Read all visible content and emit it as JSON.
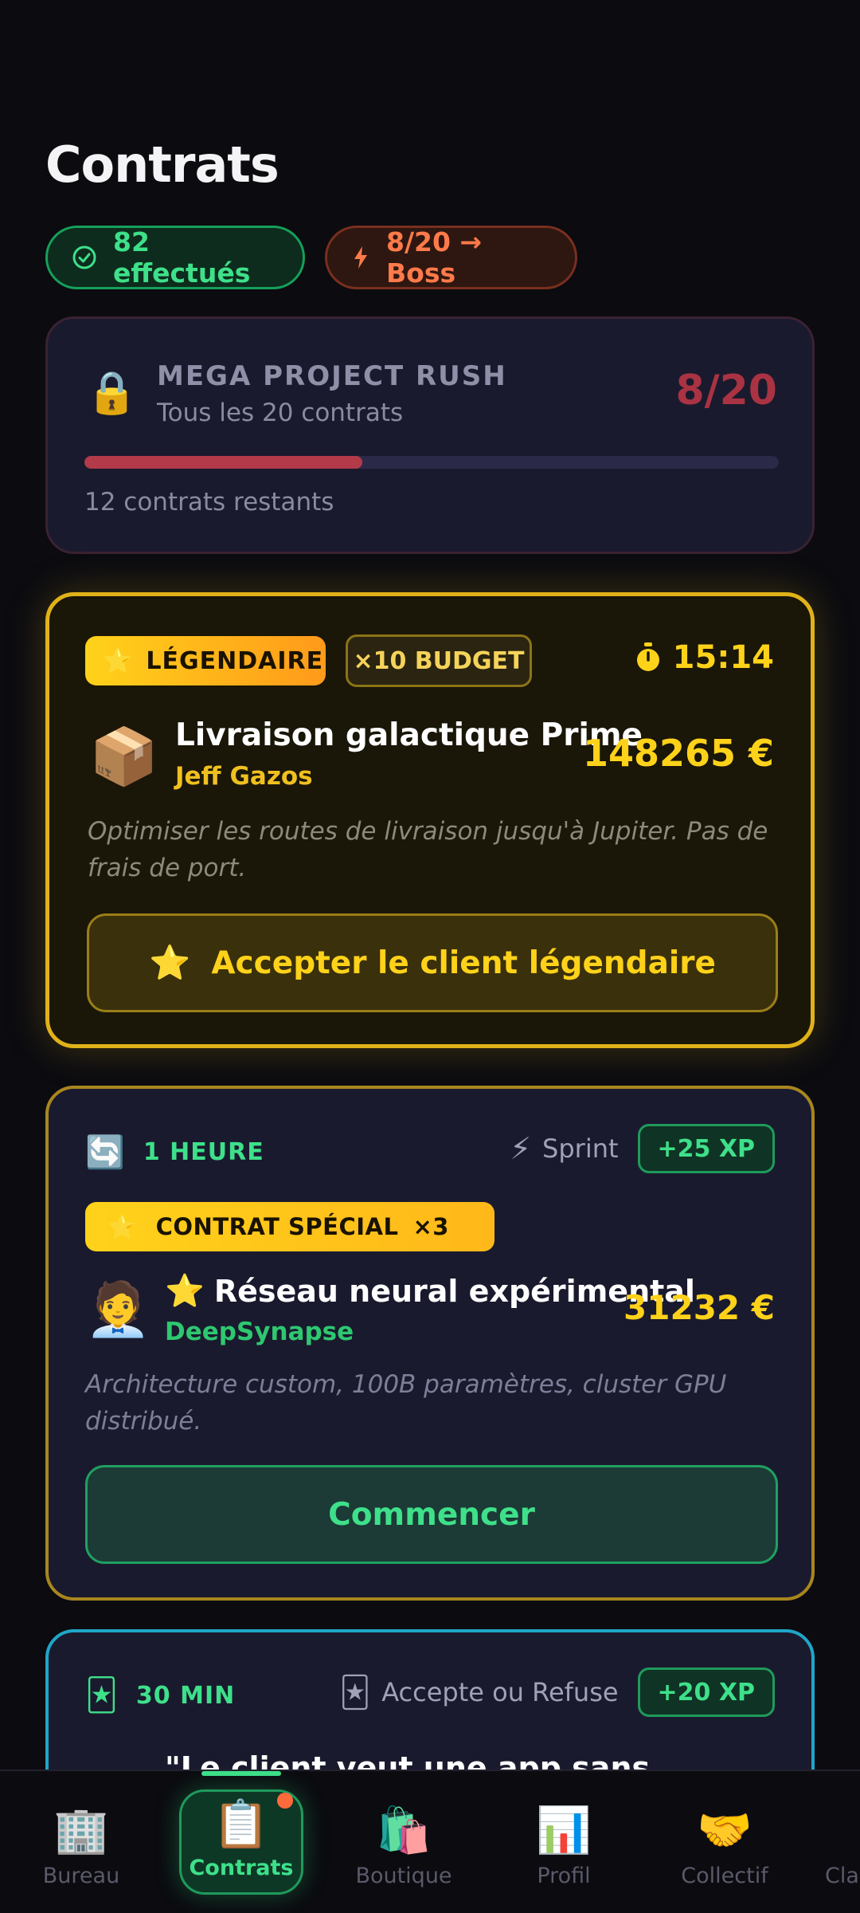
{
  "page": {
    "title": "Contrats"
  },
  "chips": {
    "done": "82 effectués",
    "boss": "8/20 → Boss"
  },
  "boss": {
    "title": "MEGA PROJECT RUSH",
    "subtitle": "Tous les 20 contrats",
    "count": "8/20",
    "progress": 0.4,
    "remaining": "12 contrats restants",
    "icon": "lock-icon"
  },
  "legendary": {
    "badge": "LÉGENDAIRE",
    "budget": "×10 BUDGET",
    "timer": "15:14",
    "name": "Livraison galactique Prime",
    "client": "Jeff Gazos",
    "price": "148265 €",
    "description": "Optimiser les routes de livraison jusqu'à Jupiter. Pas de frais de port.",
    "button": "Accepter le client légendaire"
  },
  "special": {
    "duration": "1 HEURE",
    "tag": "Sprint",
    "xp": "+25 XP",
    "badge": "CONTRAT SPÉCIAL",
    "multiplier": "×3",
    "name": "Réseau neural expérimental",
    "client": "DeepSynapse",
    "price": "31232 €",
    "description": "Architecture custom, 100B paramètres, cluster GPU distribué.",
    "button": "Commencer"
  },
  "third": {
    "duration": "30 MIN",
    "tag": "Accepte ou Refuse",
    "xp": "+20 XP",
    "name": "\"Le client veut une app sans"
  },
  "nav": {
    "items": [
      {
        "label": "Bureau",
        "icon": "office-building-icon"
      },
      {
        "label": "Contrats",
        "icon": "clipboard-icon"
      },
      {
        "label": "Boutique",
        "icon": "shopping-bags-icon"
      },
      {
        "label": "Profil",
        "icon": "bar-chart-icon"
      },
      {
        "label": "Collectif",
        "icon": "handshake-icon"
      },
      {
        "label": "Cla"
      }
    ]
  },
  "colors": {
    "background": "#0b0b10",
    "card": "#1a1a2e",
    "green": "#3ee08a",
    "gold": "#ffd21a",
    "orange": "#ff7a4a",
    "boss_red": "#b33a48"
  }
}
